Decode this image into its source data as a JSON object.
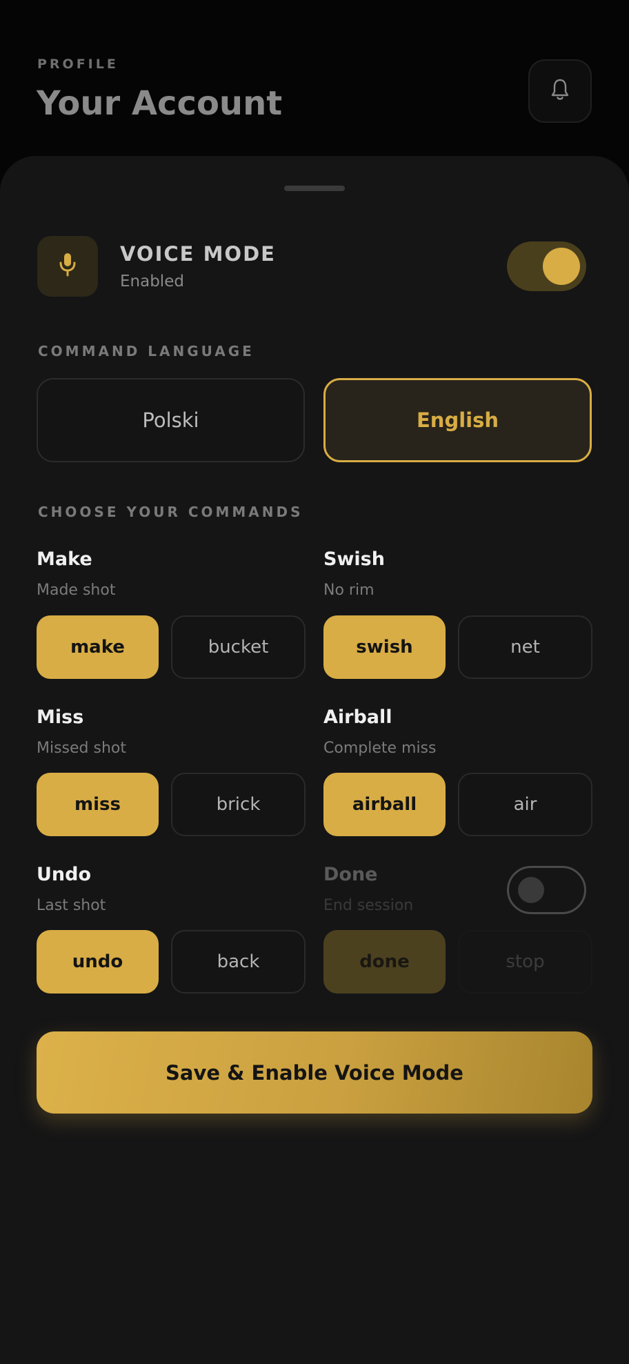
{
  "header": {
    "overline": "PROFILE",
    "title": "Your Account",
    "bell_icon": "bell-icon"
  },
  "voice_mode": {
    "title": "VOICE MODE",
    "status": "Enabled",
    "enabled": true,
    "icon": "microphone-icon"
  },
  "command_language": {
    "label": "COMMAND LANGUAGE",
    "options": [
      "Polski",
      "English"
    ],
    "selected": "English"
  },
  "commands": {
    "label": "CHOOSE YOUR COMMANDS",
    "make": {
      "title": "Make",
      "subtitle": "Made shot",
      "primary": "make",
      "secondary": "bucket"
    },
    "swish": {
      "title": "Swish",
      "subtitle": "No rim",
      "primary": "swish",
      "secondary": "net"
    },
    "miss": {
      "title": "Miss",
      "subtitle": "Missed shot",
      "primary": "miss",
      "secondary": "brick"
    },
    "airball": {
      "title": "Airball",
      "subtitle": "Complete miss",
      "primary": "airball",
      "secondary": "air"
    },
    "undo": {
      "title": "Undo",
      "subtitle": "Last shot",
      "primary": "undo",
      "secondary": "back"
    },
    "done": {
      "title": "Done",
      "subtitle": "End session",
      "primary": "done",
      "secondary": "stop",
      "enabled": false
    }
  },
  "save_button": "Save & Enable Voice Mode",
  "colors": {
    "accent": "#d8ad45",
    "background": "#050505",
    "sheet": "#151516"
  }
}
